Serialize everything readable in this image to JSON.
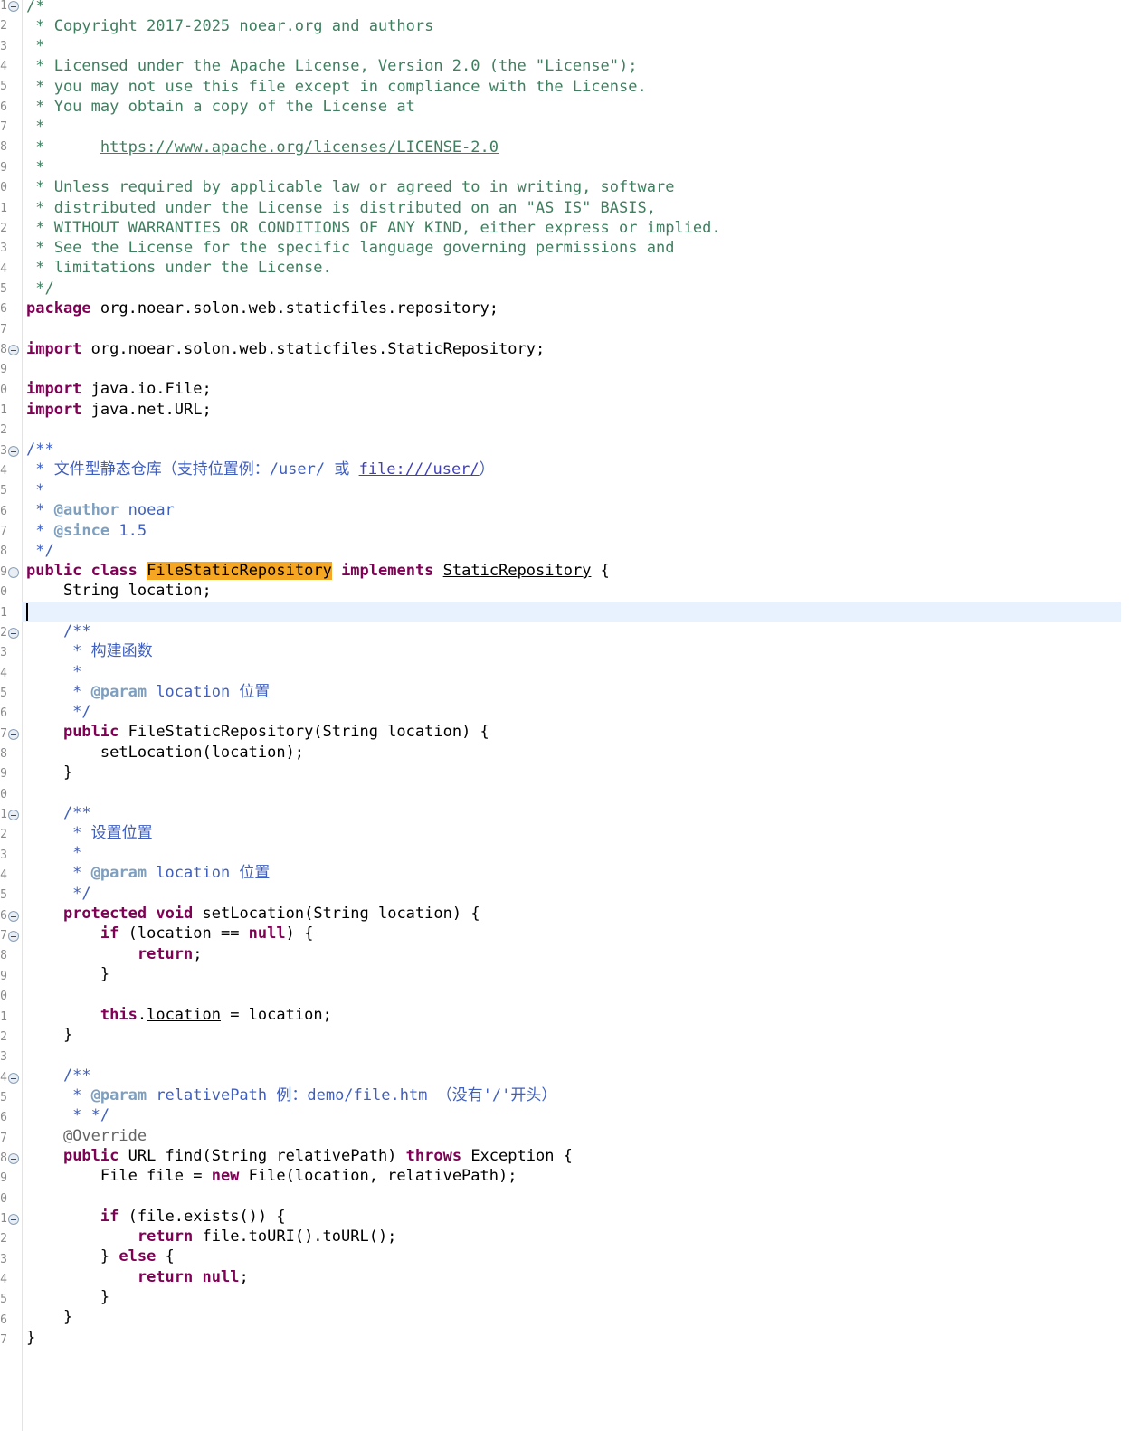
{
  "gutter": {
    "line_digits": [
      "1",
      "2",
      "3",
      "4",
      "5",
      "6",
      "7",
      "8",
      "9",
      "0",
      "1",
      "2",
      "3",
      "4",
      "5",
      "6",
      "7",
      "8",
      "9",
      "0",
      "1",
      "2",
      "3",
      "4",
      "5",
      "6",
      "7",
      "8",
      "9",
      "0",
      "1",
      "2",
      "3",
      "4",
      "5",
      "6",
      "7",
      "8",
      "9",
      "0",
      "1",
      "2",
      "3",
      "4",
      "5",
      "6",
      "7",
      "8",
      "9",
      "0",
      "1",
      "2",
      "3",
      "4",
      "5",
      "6",
      "7",
      "8",
      "9",
      "0",
      "1",
      "2",
      "3",
      "4",
      "5",
      "6",
      "7"
    ]
  },
  "code": {
    "header": {
      "l1": "/*",
      "l2": " * Copyright 2017-2025 noear.org and authors",
      "l3": " *",
      "l4": " * Licensed under the Apache License, Version 2.0 (the \"License\");",
      "l5": " * you may not use this file except in compliance with the License.",
      "l6": " * You may obtain a copy of the License at",
      "l7": " *",
      "l8_prefix": " *      ",
      "l8_url": "https://www.apache.org/licenses/LICENSE-2.0",
      "l9": " *",
      "l10": " * Unless required by applicable law or agreed to in writing, software",
      "l11": " * distributed under the License is distributed on an \"AS IS\" BASIS,",
      "l12": " * WITHOUT WARRANTIES OR CONDITIONS OF ANY KIND, either express or implied.",
      "l13": " * See the License for the specific language governing permissions and",
      "l14": " * limitations under the License.",
      "l15": " */"
    },
    "kw_package": "package",
    "package_name": " org.noear.solon.web.staticfiles.repository;",
    "kw_import": "import",
    "import1": "org.noear.solon.web.staticfiles.StaticRepository",
    "semicolon": ";",
    "import2": " java.io.File;",
    "import3": " java.net.URL;",
    "class_doc": {
      "open": "/**",
      "desc_prefix": " * 文件型静态仓库（支持位置例：/user/ 或 ",
      "desc_link": "file:///user/",
      "desc_suffix": "）",
      "blank": " *",
      "star": " * ",
      "author_tag": "@author",
      "author_val": " noear",
      "since_tag": "@since",
      "since_val": " 1.5",
      "close": " */"
    },
    "kw_public": "public",
    "kw_class": "class",
    "class_name": "FileStaticRepository",
    "kw_implements": "implements",
    "interface_name": "StaticRepository",
    "brace_open": " {",
    "field_decl": "    String location;",
    "ctor_doc": {
      "open": "    /**",
      "desc": "     * 构建函数",
      "blank": "     *",
      "star": "     * ",
      "param_tag": "@param",
      "param_val": " location 位置",
      "close": "     */"
    },
    "ctor_sig": " FileStaticRepository(String location) {",
    "ctor_body": "        setLocation(location);",
    "close_brace_4": "    }",
    "setter_doc": {
      "open": "    /**",
      "desc": "     * 设置位置",
      "blank": "     *",
      "star": "     * ",
      "param_tag": "@param",
      "param_val": " location 位置",
      "close": "     */"
    },
    "kw_protected": "protected",
    "kw_void": "void",
    "setter_sig": " setLocation(String location) {",
    "kw_if": "if",
    "if_null_a": " (location == ",
    "kw_null": "null",
    "if_null_b": ") {",
    "kw_return": "return",
    "close_brace_8": "        }",
    "kw_this": "this",
    "dot": ".",
    "field_location": "location",
    "assign_rest": " = location;",
    "find_doc": {
      "open": "    /**",
      "star": "     * ",
      "param_tag": "@param",
      "param_val": " relativePath 例：demo/file.htm （没有'/'开头）",
      "close": "     * */"
    },
    "override": "    @Override",
    "find_sig_a": " URL find(String relativePath) ",
    "kw_throws": "throws",
    "find_sig_b": " Exception {",
    "file_decl_a": "        File file = ",
    "kw_new": "new",
    "file_decl_b": " File(location, relativePath);",
    "if_exists": " (file.exists()) {",
    "return_uri": " file.toURI().toURL();",
    "else_a": "        } ",
    "kw_else": "else",
    "else_b": " {",
    "close_brace_0": "}"
  }
}
